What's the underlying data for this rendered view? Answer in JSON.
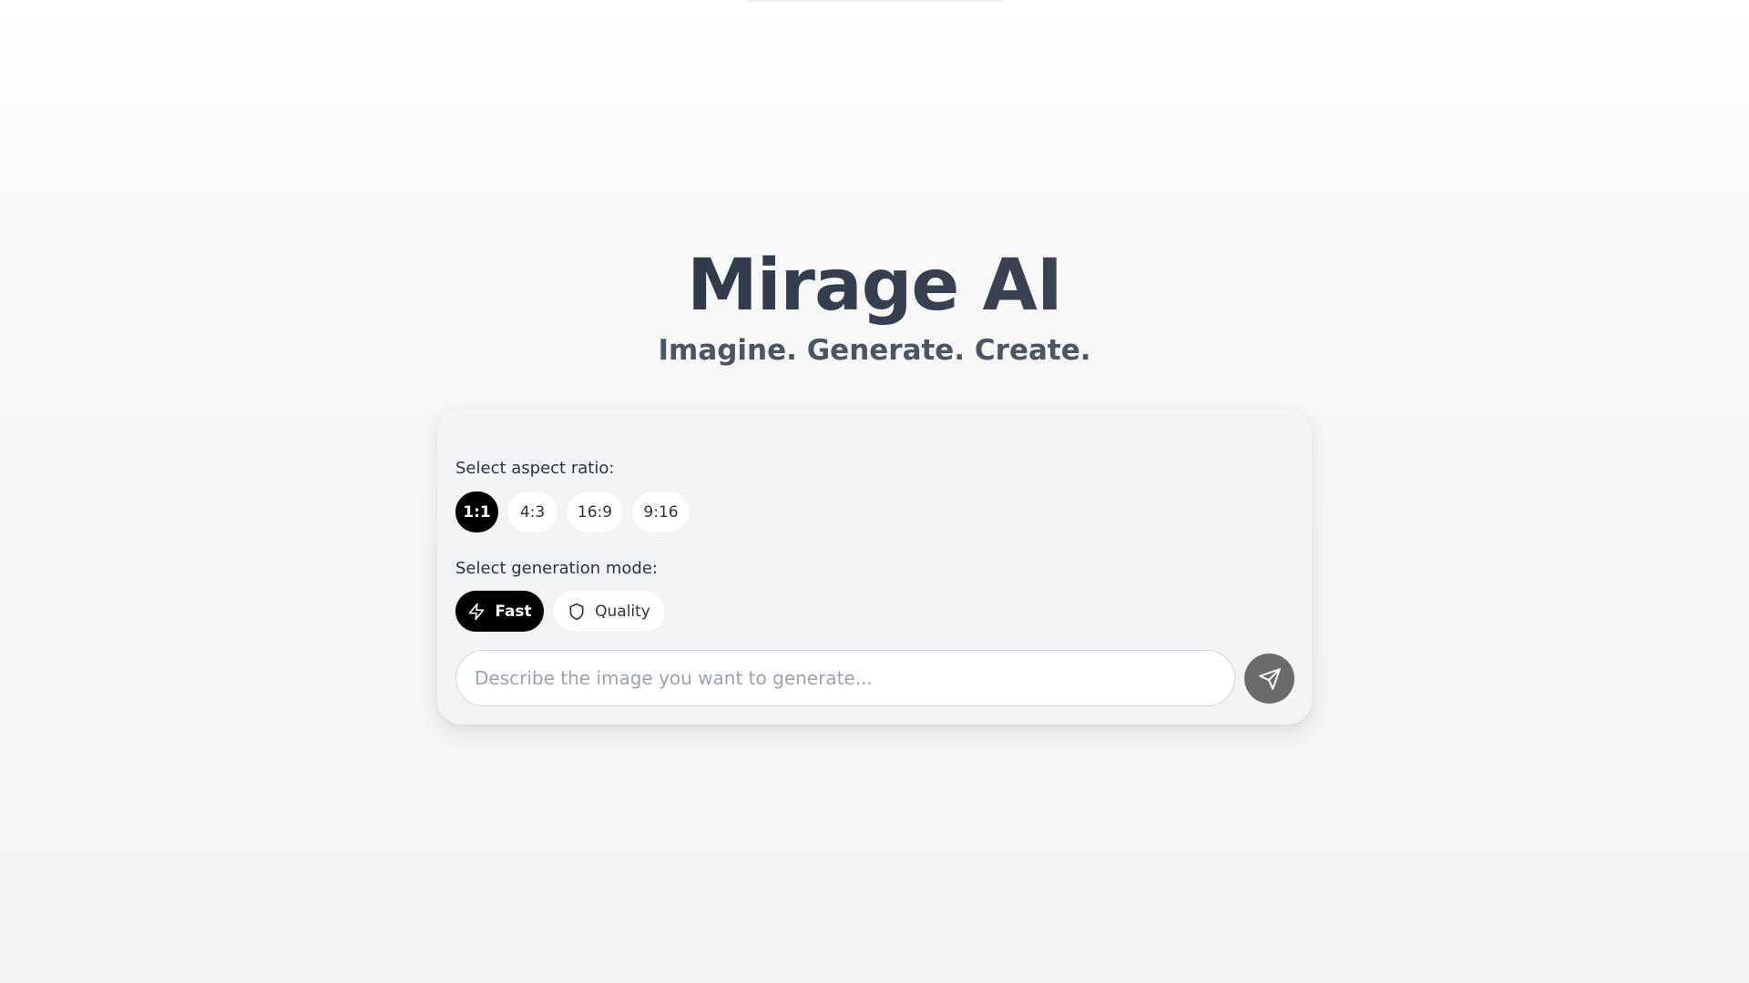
{
  "header": {
    "title": "Mirage AI",
    "subtitle": "Imagine. Generate. Create."
  },
  "aspect_ratio": {
    "label": "Select aspect ratio:",
    "options": [
      "1:1",
      "4:3",
      "16:9",
      "9:16"
    ],
    "selected": "1:1"
  },
  "generation_mode": {
    "label": "Select generation mode:",
    "options": [
      {
        "label": "Fast",
        "icon": "lightning-bolt-icon"
      },
      {
        "label": "Quality",
        "icon": "shield-icon"
      }
    ],
    "selected": "Fast"
  },
  "prompt": {
    "placeholder": "Describe the image you want to generate...",
    "value": ""
  },
  "submit": {
    "icon": "send-icon"
  },
  "colors": {
    "active_pill": "#000000",
    "inactive_pill": "#ffffff",
    "send_button": "#6b6b6b",
    "card_background": "#f3f4f6",
    "title_text": "#1e293b"
  }
}
